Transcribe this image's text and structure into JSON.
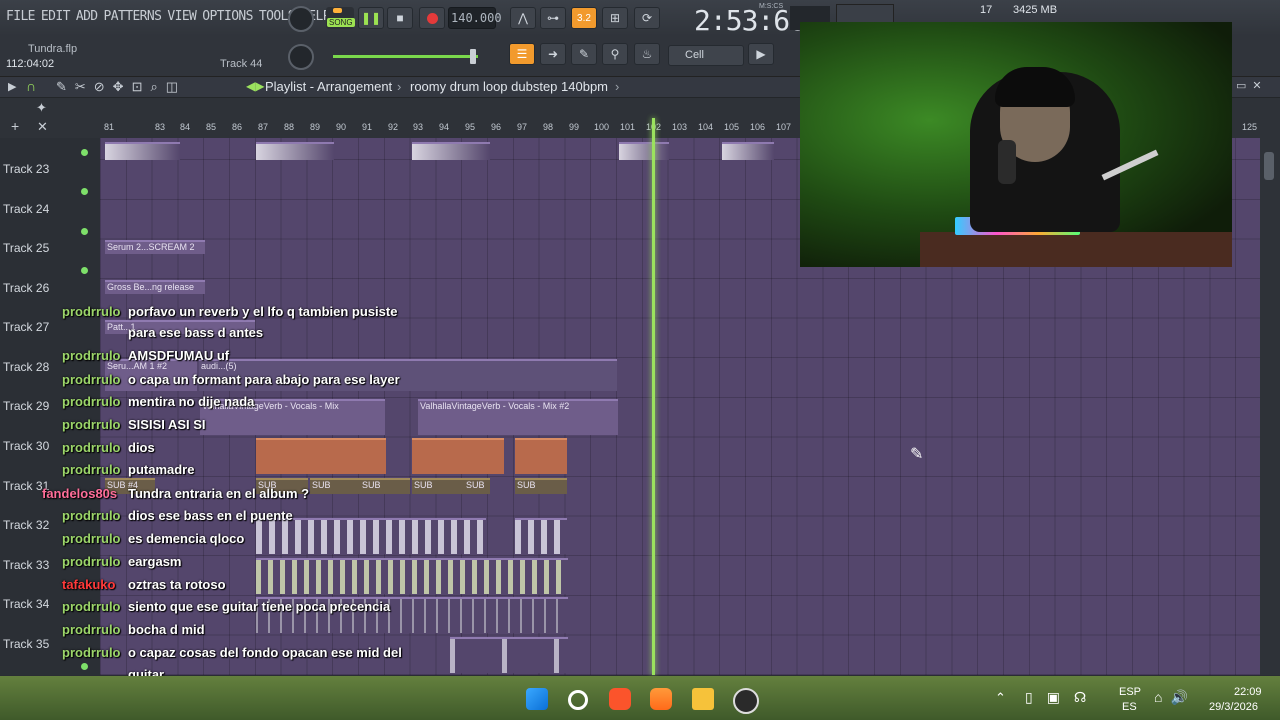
{
  "menu": [
    "FILE",
    "EDIT",
    "ADD",
    "PATTERNS",
    "VIEW",
    "OPTIONS",
    "TOOLS",
    "HELP"
  ],
  "transport": {
    "song_label": "SONG",
    "tempo": "140.000",
    "time": "2:53:60",
    "time_label": "M:S:CS",
    "step": "3.2"
  },
  "perf": {
    "cpu": "17",
    "mem": "3425 MB"
  },
  "hint": {
    "file": "Tundra.flp",
    "time": "112:04:02",
    "track": "Track 44"
  },
  "snap": {
    "label": "Cell"
  },
  "playlist": {
    "title": "Playlist - Arrangement",
    "pattern": "roomy drum loop dubstep 140bpm"
  },
  "ruler": [
    "81",
    "83",
    "84",
    "85",
    "86",
    "87",
    "88",
    "89",
    "90",
    "91",
    "92",
    "93",
    "94",
    "95",
    "96",
    "97",
    "98",
    "99",
    "100",
    "101",
    "102",
    "103",
    "104",
    "105",
    "106",
    "107",
    "125"
  ],
  "tracks": [
    "Track 23",
    "Track 24",
    "Track 25",
    "Track 26",
    "Track 27",
    "Track 28",
    "Track 29",
    "Track 30",
    "Track 31",
    "Track 32",
    "Track 33",
    "Track 34",
    "Track 35"
  ],
  "clips": {
    "serum": "Serum 2...SCREAM 2",
    "gross": "Gross Be...ng release",
    "patt": "Patt...1",
    "serum_am": "Seru...AM 1 #2",
    "audio": "audi...(5)",
    "valhalla1": "ValhallaVintageVerb - Vocals - Mix",
    "valhalla2": "ValhallaVintageVerb - Vocals - Mix #2",
    "sub4": "SUB #4",
    "sub": "SUB"
  },
  "chat": [
    {
      "user": "prodrrulo",
      "msg": "porfavo un reverb y el lfo q tambien pusiste"
    },
    {
      "user": "",
      "msg": "para ese bass d antes"
    },
    {
      "user": "prodrrulo",
      "msg": "AMSDFUMAU uf"
    },
    {
      "user": "prodrrulo",
      "msg": "o capa un formant para abajo para ese layer"
    },
    {
      "user": "prodrrulo",
      "msg": "mentira no dije nada"
    },
    {
      "user": "prodrrulo",
      "msg": "SISISI ASI SI"
    },
    {
      "user": "prodrrulo",
      "msg": "dios"
    },
    {
      "user": "prodrrulo",
      "msg": "putamadre"
    },
    {
      "user": "fandelos80s",
      "msg": "Tundra entraria en el album ?"
    },
    {
      "user": "prodrrulo",
      "msg": "dios ese bass en el puente"
    },
    {
      "user": "prodrrulo",
      "msg": "es demencia qloco"
    },
    {
      "user": "prodrrulo",
      "msg": "eargasm"
    },
    {
      "user": "tafakuko",
      "msg": "oztras ta rotoso"
    },
    {
      "user": "prodrrulo",
      "msg": "siento que ese guitar tiene poca precencia"
    },
    {
      "user": "prodrrulo",
      "msg": "bocha d mid"
    },
    {
      "user": "prodrrulo",
      "msg": "o capaz cosas del fondo opacan ese mid del"
    },
    {
      "user": "",
      "msg": "guitar"
    }
  ],
  "tray": {
    "lang1": "ESP",
    "lang2": "ES",
    "clock": "22:09",
    "date": "29/3/2026"
  },
  "colors": {
    "accent": "#9be25e",
    "grid": "#54466c",
    "username": "#9cd66a"
  }
}
